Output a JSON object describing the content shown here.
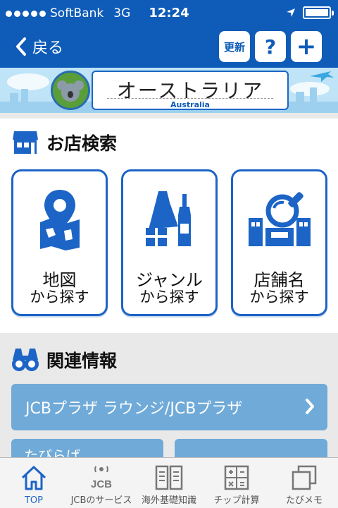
{
  "status_bar": {
    "carrier": "SoftBank",
    "network": "3G",
    "time": "12:24"
  },
  "nav": {
    "back_label": "戻る",
    "refresh_label": "更新",
    "help_label": "?",
    "add_label": "+"
  },
  "banner": {
    "title": "オーストラリア",
    "subtitle": "Australia"
  },
  "shop_search": {
    "title": "お店検索",
    "cards": [
      {
        "line1": "地図",
        "line2": "から探す",
        "icon": "map-pin-icon"
      },
      {
        "line1": "ジャンル",
        "line2": "から探す",
        "icon": "shopping-genre-icon"
      },
      {
        "line1": "店舗名",
        "line2": "から探す",
        "icon": "store-search-icon"
      }
    ]
  },
  "related": {
    "title": "関連情報",
    "primary_button": "JCBプラザ ラウンジ/JCBプラザ",
    "secondary_button_1": "たびらば",
    "secondary_button_2": ""
  },
  "tabs": [
    {
      "label": "TOP",
      "icon": "home-icon",
      "active": true
    },
    {
      "label": "JCBのサービス",
      "icon": "jcb-service-icon",
      "active": false
    },
    {
      "label": "海外基礎知識",
      "icon": "book-icon",
      "active": false
    },
    {
      "label": "チップ計算",
      "icon": "calculator-icon",
      "active": false
    },
    {
      "label": "たびメモ",
      "icon": "memo-icon",
      "active": false
    }
  ],
  "colors": {
    "brand": "#0e5cb8",
    "accent": "#1c64c6",
    "button": "#6faad8"
  }
}
